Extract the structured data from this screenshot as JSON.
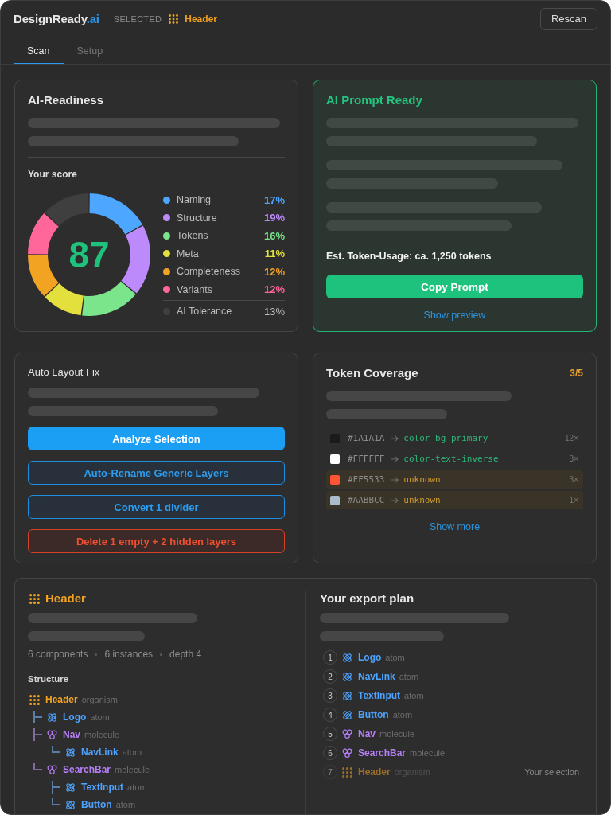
{
  "header": {
    "brand": "DesignReady",
    "brand_suffix": ".ai",
    "selection_label": "SELECTED",
    "selection": {
      "name": "Header"
    },
    "rescan_button": "Rescan"
  },
  "tabs": [
    {
      "label": "Scan",
      "selected": true
    },
    {
      "label": "Setup",
      "selected": false
    }
  ],
  "readiness": {
    "title": "AI-Readiness",
    "score_label": "Your score",
    "score": "87",
    "chart_data": {
      "type": "donut",
      "legend": "right",
      "categories": [
        "Naming",
        "Structure",
        "Tokens",
        "Meta",
        "Completeness",
        "Variants",
        "AI Tolerance"
      ],
      "values": [
        17,
        19,
        16,
        11,
        12,
        12,
        13
      ],
      "value_labels": [
        "17%",
        "19%",
        "16%",
        "11%",
        "12%",
        "12%",
        "13%"
      ],
      "colors": [
        "#4da6ff",
        "#bd8afc",
        "#7be58c",
        "#e3df3c",
        "#f3a322",
        "#ff6699",
        "#3f3f3f"
      ]
    }
  },
  "prompt": {
    "title": "AI Prompt Ready",
    "token_usage": "Est. Token-Usage: ca. 1,250 tokens",
    "copy_button": "Copy Prompt",
    "preview_link": "Show preview"
  },
  "auto_layout": {
    "title": "Auto Layout Fix",
    "actions": [
      {
        "label": "Analyze Selection",
        "kind": "primary"
      },
      {
        "label": "Auto-Rename Generic Layers",
        "kind": "outline"
      },
      {
        "label": "Convert 1 divider",
        "kind": "outline"
      },
      {
        "label": "Delete 1 empty + 2 hidden layers",
        "kind": "danger"
      }
    ]
  },
  "token_coverage": {
    "title": "Token Coverage",
    "count": "3/5",
    "tokens": [
      {
        "hex": "#1A1A1A",
        "color": "#1a1a1a",
        "token": "color-bg-primary",
        "mapped": true,
        "uses": "12×"
      },
      {
        "hex": "#FFFFFF",
        "color": "#ffffff",
        "token": "color-text-inverse",
        "mapped": true,
        "uses": "8×"
      },
      {
        "hex": "#FF5533",
        "color": "#ff5533",
        "token": "unknown",
        "mapped": false,
        "uses": "3×"
      },
      {
        "hex": "#AABBCC",
        "color": "#aabbcc",
        "token": "unknown",
        "mapped": false,
        "uses": "1×"
      }
    ],
    "more_link": "Show more"
  },
  "component": {
    "name": "Header",
    "stats": [
      "6 components",
      "6 instances",
      "depth 4"
    ],
    "structure_label": "Structure",
    "tree": [
      {
        "name": "Header",
        "type": "organism",
        "children": [
          {
            "name": "Logo",
            "type": "atom"
          },
          {
            "name": "Nav",
            "type": "molecule",
            "children": [
              {
                "name": "NavLink",
                "type": "atom"
              }
            ]
          },
          {
            "name": "SearchBar",
            "type": "molecule",
            "children": [
              {
                "name": "TextInput",
                "type": "atom"
              },
              {
                "name": "Button",
                "type": "atom"
              }
            ]
          }
        ]
      }
    ]
  },
  "export_plan": {
    "title": "Your export plan",
    "steps": [
      {
        "number": "1",
        "name": "Logo",
        "type": "atom",
        "selected": false
      },
      {
        "number": "2",
        "name": "NavLink",
        "type": "atom",
        "selected": false
      },
      {
        "number": "3",
        "name": "TextInput",
        "type": "atom",
        "selected": false
      },
      {
        "number": "4",
        "name": "Button",
        "type": "atom",
        "selected": false
      },
      {
        "number": "5",
        "name": "Nav",
        "type": "molecule",
        "selected": false
      },
      {
        "number": "6",
        "name": "SearchBar",
        "type": "molecule",
        "selected": false
      },
      {
        "number": "7",
        "name": "Header",
        "type": "organism",
        "selected": true,
        "note": "Your selection"
      }
    ]
  }
}
